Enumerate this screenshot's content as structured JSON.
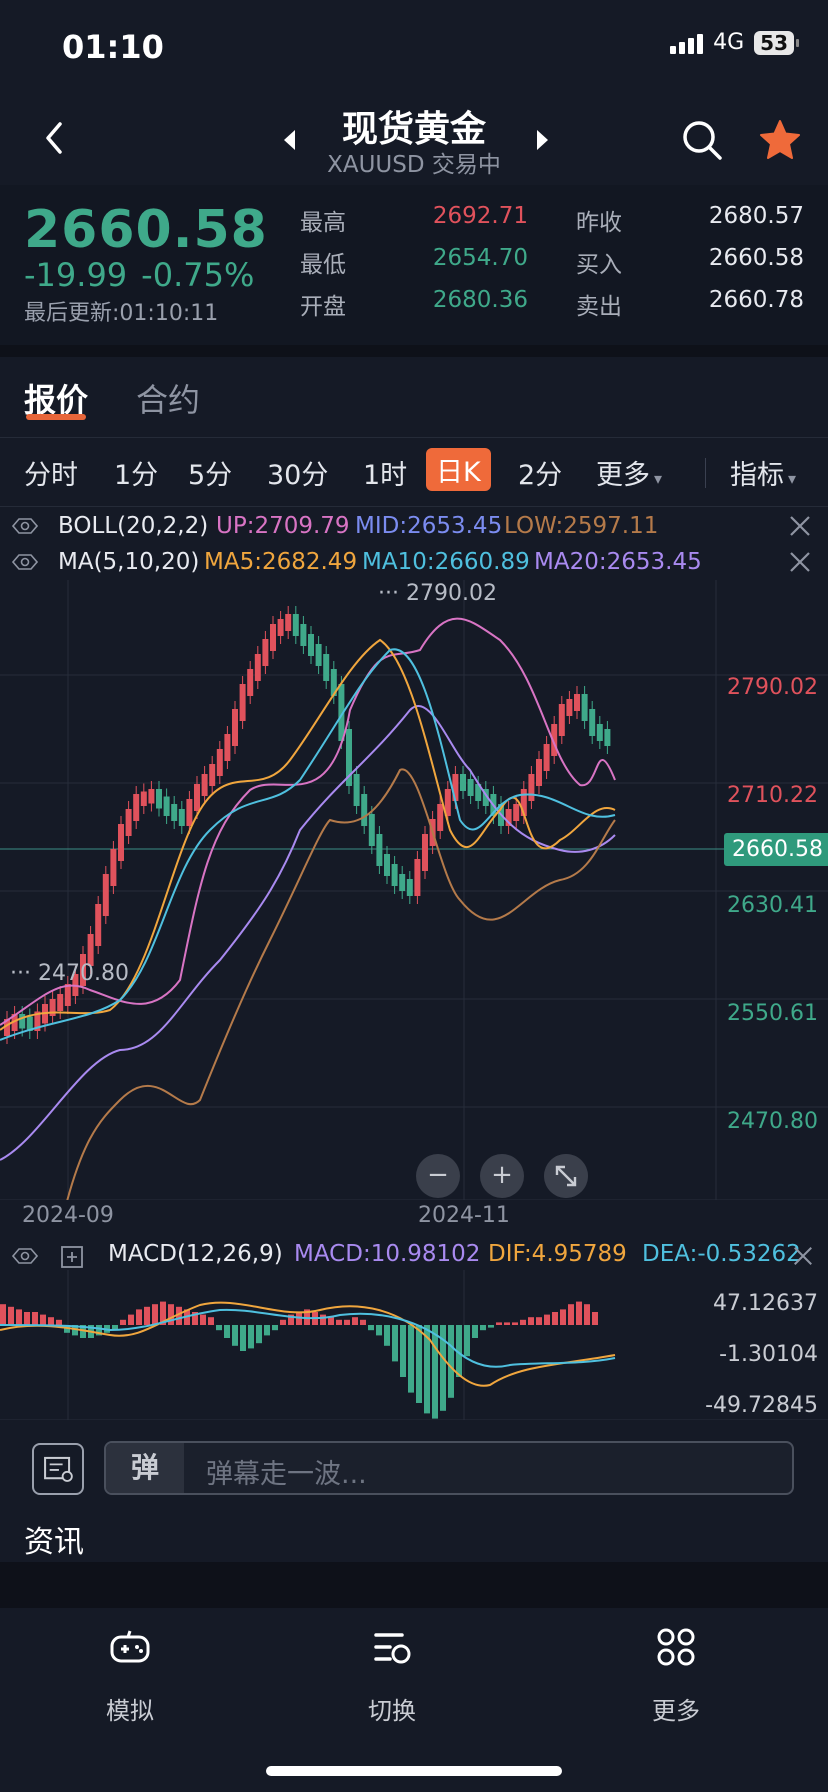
{
  "status": {
    "time": "01:10",
    "network": "4G",
    "battery": "53"
  },
  "header": {
    "title": "现货黄金",
    "subtitle": "XAUUSD 交易中"
  },
  "quote": {
    "price": "2660.58",
    "change": "-19.99",
    "change_pct": "-0.75%",
    "updated": "最后更新:01:10:11",
    "high_label": "最高",
    "high": "2692.71",
    "low_label": "最低",
    "low": "2654.70",
    "open_label": "开盘",
    "open": "2680.36",
    "prev_close_label": "昨收",
    "prev_close": "2680.57",
    "bid_label": "买入",
    "bid": "2660.58",
    "ask_label": "卖出",
    "ask": "2660.78"
  },
  "tabs": {
    "quote": "报价",
    "contract": "合约"
  },
  "periods": [
    "分时",
    "1分",
    "5分",
    "30分",
    "1时",
    "日K",
    "2分",
    "更多",
    "指标"
  ],
  "active_period": "日K",
  "indicators": {
    "boll": {
      "name": "BOLL(20,2,2)",
      "up": "UP:2709.79",
      "mid": "MID:2653.45",
      "low": "LOW:2597.11"
    },
    "ma": {
      "name": "MA(5,10,20)",
      "ma5": "MA5:2682.49",
      "ma10": "MA10:2660.89",
      "ma20": "MA20:2653.45"
    },
    "macd": {
      "name": "MACD(12,26,9)",
      "macd": "MACD:10.98102",
      "dif": "DIF:4.95789",
      "dea": "DEA:-0.53262"
    }
  },
  "chart": {
    "y_labels": [
      "2790.02",
      "2710.22",
      "2630.41",
      "2550.61",
      "2470.80"
    ],
    "current_price_tag": "2660.58",
    "max_marker": "2790.02",
    "min_marker": "2470.80",
    "dates": [
      "2024-09",
      "2024-11"
    ],
    "macd_labels": [
      "47.12637",
      "-1.30104",
      "-49.72845"
    ],
    "zoom_out": "−",
    "zoom_in": "+"
  },
  "danmu": {
    "button": "弹",
    "placeholder": "弹幕走一波..."
  },
  "news": {
    "title": "资讯"
  },
  "bottom_nav": {
    "simulate": "模拟",
    "switch": "切换",
    "more": "更多"
  },
  "colors": {
    "up": "#e0525c",
    "down": "#3fa98a",
    "accent": "#ef6a3a",
    "boll_up": "#d874c4",
    "boll_mid": "#7b8cf0",
    "boll_low": "#b47a4a",
    "ma5": "#f0a63e",
    "ma10": "#4fc0df",
    "ma20": "#a98af0"
  }
}
